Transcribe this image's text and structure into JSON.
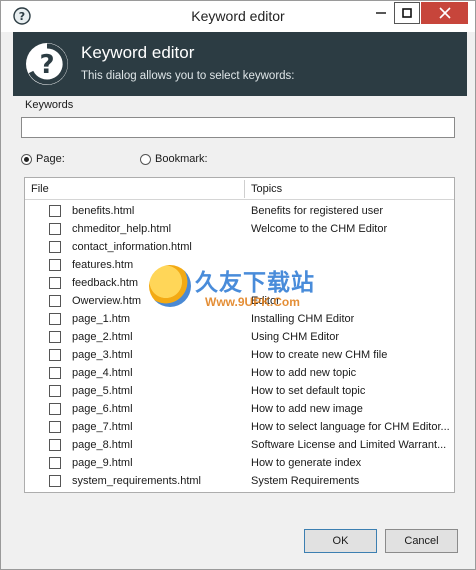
{
  "window": {
    "title": "Keyword editor"
  },
  "banner": {
    "title": "Keyword editor",
    "subtitle": "This dialog allows you to select keywords:"
  },
  "keywords": {
    "label": "Keywords",
    "value": ""
  },
  "radios": {
    "page_label": "Page:",
    "bookmark_label": "Bookmark:",
    "selected": "page"
  },
  "table": {
    "col_file": "File",
    "col_topics": "Topics",
    "rows": [
      {
        "file": "benefits.html",
        "topic": "Benefits for registered user"
      },
      {
        "file": "chmeditor_help.html",
        "topic": "Welcome to the CHM Editor"
      },
      {
        "file": "contact_information.html",
        "topic": ""
      },
      {
        "file": "features.htm",
        "topic": ""
      },
      {
        "file": "feedback.htm",
        "topic": ""
      },
      {
        "file": "Owerview.htm",
        "topic": "Editor"
      },
      {
        "file": "page_1.htm",
        "topic": "Installing CHM Editor"
      },
      {
        "file": "page_2.html",
        "topic": "Using CHM Editor"
      },
      {
        "file": "page_3.html",
        "topic": "How to create new CHM file"
      },
      {
        "file": "page_4.html",
        "topic": "How to add new topic"
      },
      {
        "file": "page_5.html",
        "topic": "How to set default topic"
      },
      {
        "file": "page_6.html",
        "topic": "How to add new image"
      },
      {
        "file": "page_7.html",
        "topic": "How to select language for CHM Editor..."
      },
      {
        "file": "page_8.html",
        "topic": "Software License and Limited Warrant..."
      },
      {
        "file": "page_9.html",
        "topic": "How to generate index"
      },
      {
        "file": "system_requirements.html",
        "topic": "System Requirements"
      }
    ]
  },
  "buttons": {
    "ok": "OK",
    "cancel": "Cancel"
  },
  "watermark": {
    "title": "久友下载站",
    "url": "Www.9UPK.Com"
  },
  "colors": {
    "banner": "#2c3c43",
    "close": "#c7453b"
  }
}
